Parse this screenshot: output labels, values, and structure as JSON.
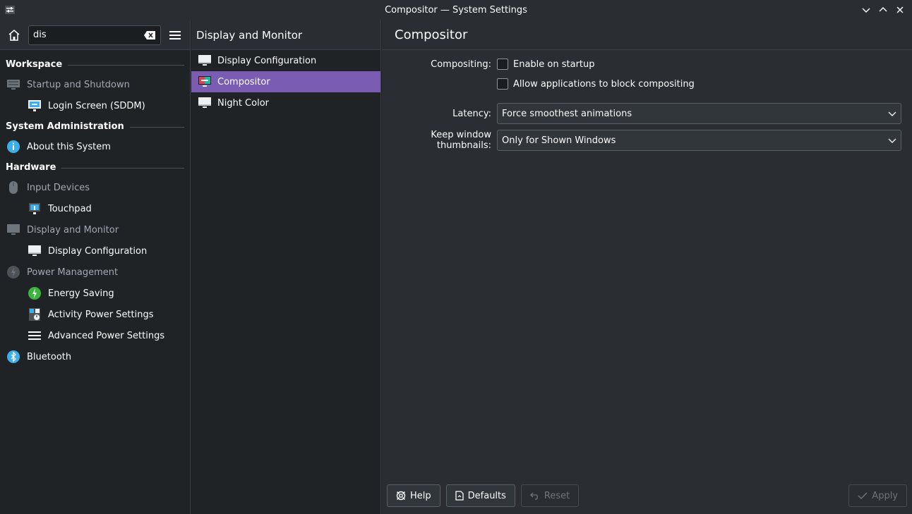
{
  "window": {
    "title": "Compositor — System Settings"
  },
  "sidebar": {
    "search_value": "dis",
    "sections": [
      {
        "header": "Workspace",
        "items": [
          {
            "label": "Startup and Shutdown",
            "muted": true,
            "child": false,
            "icon": "startup-icon"
          },
          {
            "label": "Login Screen (SDDM)",
            "muted": false,
            "child": true,
            "icon": "login-screen-icon"
          }
        ]
      },
      {
        "header": "System Administration",
        "items": [
          {
            "label": "About this System",
            "muted": false,
            "child": false,
            "icon": "info-icon"
          }
        ]
      },
      {
        "header": "Hardware",
        "items": [
          {
            "label": "Input Devices",
            "muted": true,
            "child": false,
            "icon": "mouse-icon"
          },
          {
            "label": "Touchpad",
            "muted": false,
            "child": true,
            "icon": "touchpad-icon"
          },
          {
            "label": "Display and Monitor",
            "muted": true,
            "child": false,
            "icon": "monitor-icon"
          },
          {
            "label": "Display Configuration",
            "muted": false,
            "child": true,
            "icon": "display-icon"
          },
          {
            "label": "Power Management",
            "muted": true,
            "child": false,
            "icon": "power-icon"
          },
          {
            "label": "Energy Saving",
            "muted": false,
            "child": true,
            "icon": "energy-icon"
          },
          {
            "label": "Activity Power Settings",
            "muted": false,
            "child": true,
            "icon": "activity-power-icon"
          },
          {
            "label": "Advanced Power Settings",
            "muted": false,
            "child": true,
            "icon": "list-icon"
          },
          {
            "label": "Bluetooth",
            "muted": false,
            "child": false,
            "icon": "bluetooth-icon"
          }
        ]
      }
    ]
  },
  "middle": {
    "header": "Display and Monitor",
    "items": [
      {
        "label": "Display Configuration",
        "selected": false,
        "icon": "display-icon"
      },
      {
        "label": "Compositor",
        "selected": true,
        "icon": "compositor-icon"
      },
      {
        "label": "Night Color",
        "selected": false,
        "icon": "display-icon"
      }
    ]
  },
  "content": {
    "title": "Compositor",
    "compositing_label": "Compositing:",
    "enable_on_startup": "Enable on startup",
    "allow_block": "Allow applications to block compositing",
    "latency_label": "Latency:",
    "latency_value": "Force smoothest animations",
    "thumbnails_label": "Keep window thumbnails:",
    "thumbnails_value": "Only for Shown Windows"
  },
  "footer": {
    "help": "Help",
    "defaults": "Defaults",
    "reset": "Reset",
    "apply": "Apply"
  },
  "colors": {
    "accent": "#7a5db2",
    "background": "#202326",
    "panel": "#2a2e32"
  }
}
